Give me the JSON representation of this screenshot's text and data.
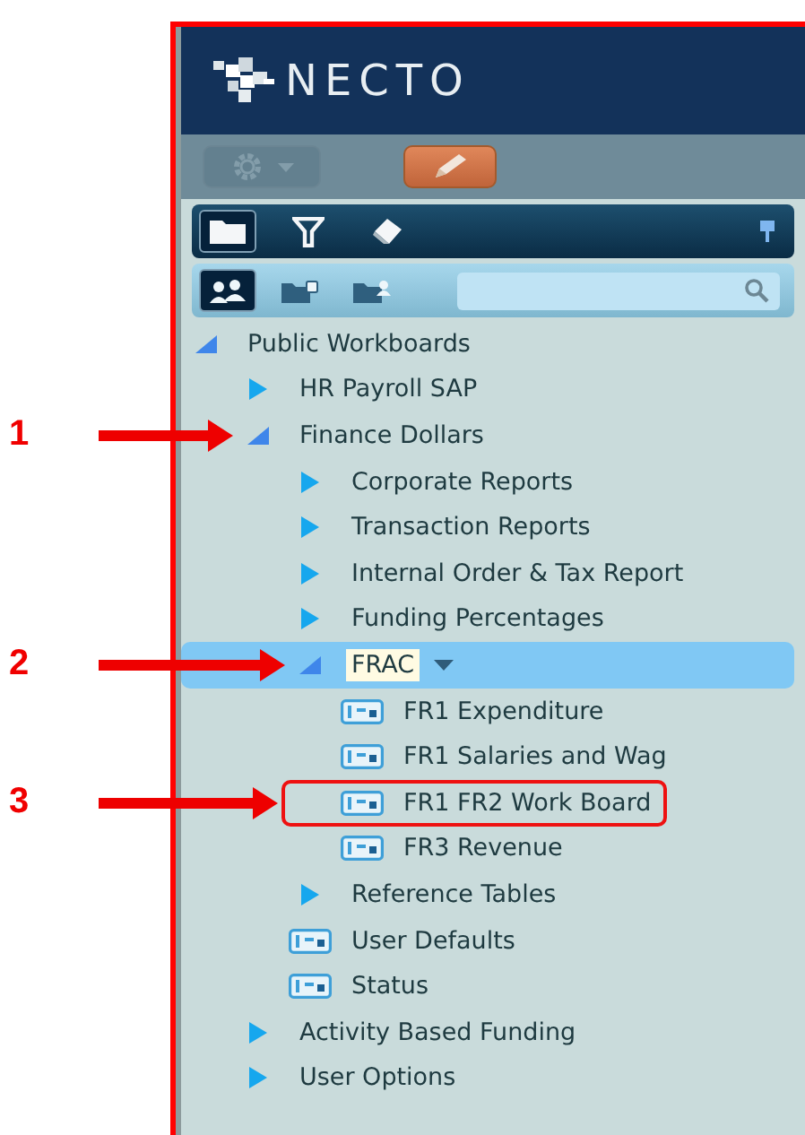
{
  "logo": {
    "text": "NECTO"
  },
  "toolbar": [
    {
      "kind": "settings",
      "disabled": true
    },
    {
      "kind": "edit",
      "disabled": false
    }
  ],
  "view_tabs": [
    {
      "kind": "folder",
      "selected": true
    },
    {
      "kind": "filter",
      "selected": false
    },
    {
      "kind": "eraser",
      "selected": false
    }
  ],
  "source_tabs": [
    {
      "kind": "group",
      "selected": true
    },
    {
      "kind": "locked-folder",
      "selected": false
    },
    {
      "kind": "shared-folder",
      "selected": false
    }
  ],
  "tree": [
    {
      "label": "Public Workboards",
      "kind": "folder",
      "expanded": true,
      "selected": false,
      "outlined": false,
      "children": [
        {
          "label": "HR Payroll SAP",
          "kind": "folder",
          "expanded": false,
          "selected": false,
          "outlined": false
        },
        {
          "label": "Finance Dollars",
          "kind": "folder",
          "expanded": true,
          "selected": false,
          "outlined": false,
          "annotation": "1",
          "children": [
            {
              "label": "Corporate Reports",
              "kind": "folder",
              "expanded": false,
              "selected": false,
              "outlined": false
            },
            {
              "label": "Transaction Reports",
              "kind": "folder",
              "expanded": false,
              "selected": false,
              "outlined": false
            },
            {
              "label": "Internal Order & Tax Report",
              "kind": "folder",
              "expanded": false,
              "selected": false,
              "outlined": false
            },
            {
              "label": "Funding Percentages",
              "kind": "folder",
              "expanded": false,
              "selected": false,
              "outlined": false
            },
            {
              "label": "FRAC",
              "kind": "folder",
              "expanded": true,
              "selected": true,
              "outlined": false,
              "annotation": "2",
              "children": [
                {
                  "label": "FR1 Expenditure",
                  "kind": "workbook",
                  "selected": false,
                  "outlined": false
                },
                {
                  "label": "FR1 Salaries and Wag",
                  "kind": "workbook",
                  "selected": false,
                  "outlined": false
                },
                {
                  "label": "FR1 FR2 Work Board",
                  "kind": "workbook",
                  "selected": false,
                  "outlined": true,
                  "annotation": "3"
                },
                {
                  "label": "FR3 Revenue",
                  "kind": "workbook",
                  "selected": false,
                  "outlined": false
                }
              ]
            },
            {
              "label": "Reference Tables",
              "kind": "folder",
              "expanded": false,
              "selected": false,
              "outlined": false
            },
            {
              "label": "User Defaults",
              "kind": "workbook",
              "selected": false,
              "outlined": false
            },
            {
              "label": "Status",
              "kind": "workbook",
              "selected": false,
              "outlined": false
            }
          ]
        },
        {
          "label": "Activity Based Funding",
          "kind": "folder",
          "expanded": false,
          "selected": false,
          "outlined": false
        },
        {
          "label": "User Options",
          "kind": "folder",
          "expanded": false,
          "selected": false,
          "outlined": false
        }
      ]
    }
  ]
}
